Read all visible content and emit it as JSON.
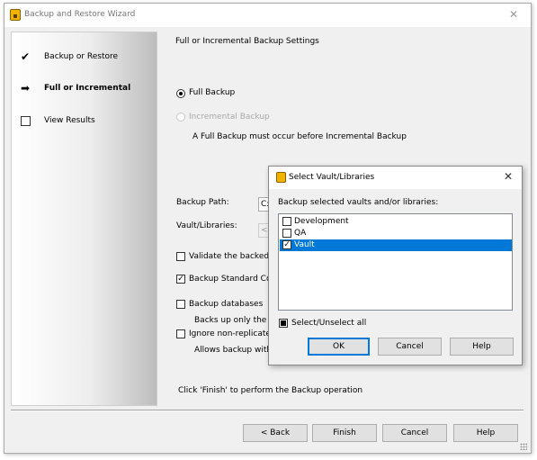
{
  "window": {
    "title": "Backup and Restore Wizard",
    "close_glyph": "✕"
  },
  "sidebar": {
    "steps": [
      {
        "label": "Backup or Restore",
        "icon": "checkmark-icon",
        "glyph": "✔"
      },
      {
        "label": "Full or Incremental",
        "icon": "arrow-right-icon",
        "glyph": "➡"
      },
      {
        "label": "View Results",
        "icon": "empty-box-icon",
        "glyph": ""
      }
    ]
  },
  "main": {
    "heading": "Full or Incremental Backup Settings",
    "full_backup_label": "Full Backup",
    "incremental_label": "Incremental Backup",
    "note": "A Full Backup must occur before Incremental Backup",
    "backup_path_label": "Backup Path:",
    "backup_path_value": "C:",
    "vault_libraries_label": "Vault/Libraries:",
    "vault_libraries_value": "<A",
    "validate_label": "Validate the backed up",
    "backup_standard_label": "Backup Standard Cont",
    "backup_databases_label": "Backup databases",
    "backs_up_only_text": "Backs up only the va",
    "ignore_label": "Ignore non-replicated",
    "allows_backup_text": "Allows backup witho",
    "finish_hint": "Click 'Finish' to perform the Backup operation"
  },
  "buttons": {
    "back": "< Back",
    "finish": "Finish",
    "cancel": "Cancel",
    "help": "Help"
  },
  "dialog": {
    "title": "Select Vault/Libraries",
    "close_glyph": "✕",
    "prompt": "Backup selected vaults and/or libraries:",
    "items": [
      {
        "label": "Development",
        "checked": false,
        "selected": false
      },
      {
        "label": "QA",
        "checked": false,
        "selected": false
      },
      {
        "label": "Vault",
        "checked": true,
        "selected": true
      }
    ],
    "select_all_label": "Select/Unselect all",
    "ok": "OK",
    "cancel": "Cancel",
    "help": "Help",
    "accent_color": "#0078d7"
  }
}
